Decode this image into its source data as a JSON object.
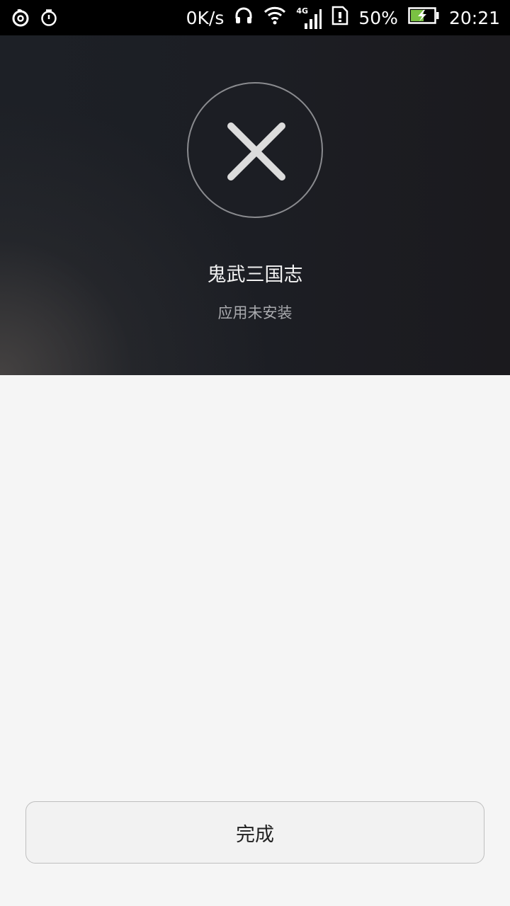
{
  "status_bar": {
    "speed": "0K/s",
    "network": "4G",
    "battery": "50%",
    "time": "20:21",
    "icons": [
      "netease-music-icon",
      "alarm-icon",
      "headphones-icon",
      "wifi-icon",
      "signal-icon",
      "sim-alert-icon",
      "battery-icon"
    ]
  },
  "result": {
    "icon": "close-icon",
    "app_name": "鬼武三国志",
    "status": "应用未安装"
  },
  "footer": {
    "done_label": "完成"
  },
  "colors": {
    "hero_bg": "#1c1e24",
    "page_bg": "#f5f5f5",
    "battery_fill": "#7ac143"
  }
}
